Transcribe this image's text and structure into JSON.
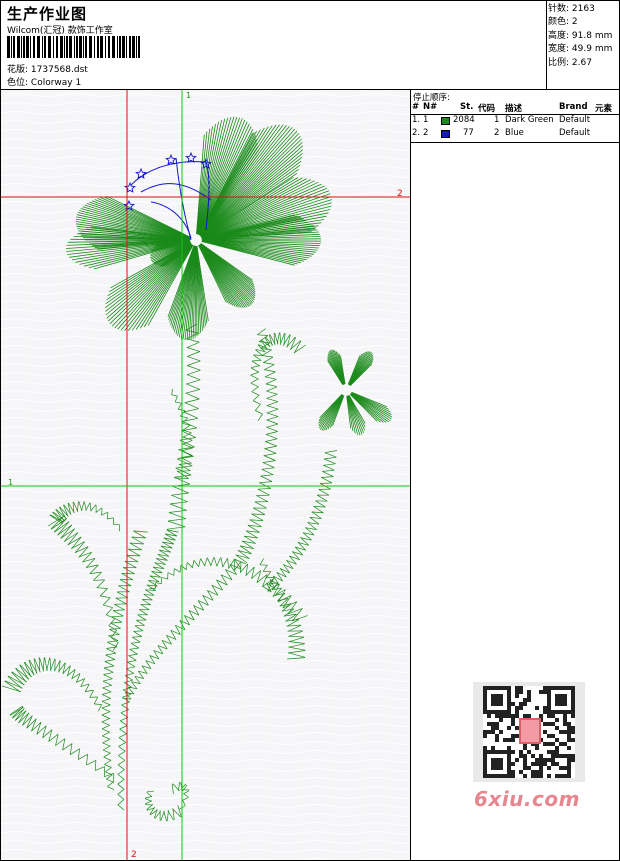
{
  "header": {
    "title": "生产作业图",
    "subtitle": "Wilcom(汇冠) 款饰工作室",
    "design_label": "花版:",
    "design_value": "1737568.dst",
    "colorway_label": "色位:",
    "colorway_value": "Colorway 1"
  },
  "stats": {
    "stitches_label": "针数:",
    "stitches_value": "2163",
    "colors_label": "颜色:",
    "colors_value": "2",
    "height_label": "高度:",
    "height_value": "91.8 mm",
    "width_label": "宽度:",
    "width_value": "49.9 mm",
    "ratio_label": "比例:",
    "ratio_value": "2.67"
  },
  "legend": {
    "title": "停止顺序:",
    "columns": [
      "#",
      "N#",
      "St.",
      "代码",
      "描述",
      "Brand",
      "元素"
    ],
    "rows": [
      {
        "num": "1.",
        "n": "1",
        "st": "2084",
        "code": "1",
        "desc": "Dark Green",
        "brand": "Default",
        "color": "#1a8a1a"
      },
      {
        "num": "2.",
        "n": "2",
        "st": "77",
        "code": "2",
        "desc": "Blue",
        "brand": "Default",
        "color": "#1414c8"
      }
    ]
  },
  "markers": {
    "green_top": "1",
    "green_left": "1",
    "red_right": "2",
    "red_bottom": "2"
  },
  "colors": {
    "stitch_green": "#1a8a1a",
    "stitch_blue": "#1414c8",
    "guide_red": "#e01010",
    "guide_green": "#10c810"
  },
  "watermark": "6xiu.com"
}
